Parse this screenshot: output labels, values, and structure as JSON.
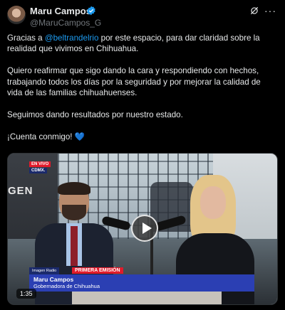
{
  "author": {
    "name": "Maru Campos",
    "handle": "@MaruCampos_G"
  },
  "post": {
    "p1_before": "Gracias a ",
    "p1_mention": "@beltrandelrio",
    "p1_after": " por este espacio, para dar claridad sobre la realidad que vivimos en Chihuahua.",
    "p2": "Quiero reafirmar que sigo dando la cara y respondiendo con hechos, trabajando todos los días por la seguridad y por mejorar la calidad de vida de las familias chihuahuenses.",
    "p3": "Seguimos dando resultados por nuestro estado.",
    "p4": "¡Cuenta conmigo!",
    "p4_emoji": "💙"
  },
  "video": {
    "duration": "1:35",
    "backdrop_text": "GEN",
    "live_tag": "EN VIVO",
    "live_location": "CDMX.",
    "brand_label": "Imagen Radio",
    "emission_label": "PRIMERA EMISIÓN",
    "lower_third_name": "Maru Campos",
    "lower_third_title": "Gobernadora de Chihuahua"
  },
  "icons": {
    "verified": "verified-badge-icon",
    "grok": "grok-icon",
    "more": "more-icon",
    "play": "play-icon"
  },
  "colors": {
    "mention": "#1d9bf0",
    "verified": "#1d9bf0",
    "lower_third": "#2b3fb3",
    "live_red": "#e11b2b"
  }
}
